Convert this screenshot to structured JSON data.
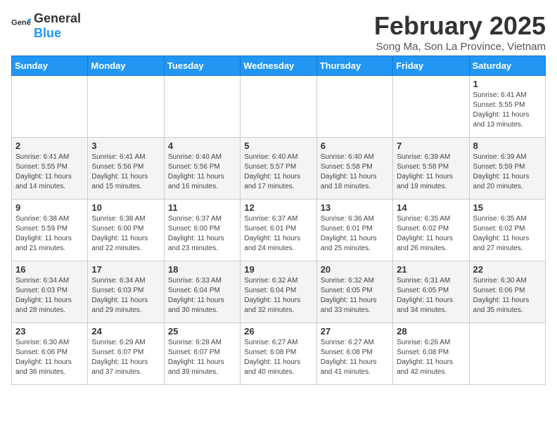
{
  "logo": {
    "text_general": "General",
    "text_blue": "Blue"
  },
  "title": "February 2025",
  "subtitle": "Song Ma, Son La Province, Vietnam",
  "days_of_week": [
    "Sunday",
    "Monday",
    "Tuesday",
    "Wednesday",
    "Thursday",
    "Friday",
    "Saturday"
  ],
  "weeks": [
    [
      {
        "day": "",
        "info": ""
      },
      {
        "day": "",
        "info": ""
      },
      {
        "day": "",
        "info": ""
      },
      {
        "day": "",
        "info": ""
      },
      {
        "day": "",
        "info": ""
      },
      {
        "day": "",
        "info": ""
      },
      {
        "day": "1",
        "info": "Sunrise: 6:41 AM\nSunset: 5:55 PM\nDaylight: 11 hours and 13 minutes."
      }
    ],
    [
      {
        "day": "2",
        "info": "Sunrise: 6:41 AM\nSunset: 5:55 PM\nDaylight: 11 hours and 14 minutes."
      },
      {
        "day": "3",
        "info": "Sunrise: 6:41 AM\nSunset: 5:56 PM\nDaylight: 11 hours and 15 minutes."
      },
      {
        "day": "4",
        "info": "Sunrise: 6:40 AM\nSunset: 5:56 PM\nDaylight: 11 hours and 16 minutes."
      },
      {
        "day": "5",
        "info": "Sunrise: 6:40 AM\nSunset: 5:57 PM\nDaylight: 11 hours and 17 minutes."
      },
      {
        "day": "6",
        "info": "Sunrise: 6:40 AM\nSunset: 5:58 PM\nDaylight: 11 hours and 18 minutes."
      },
      {
        "day": "7",
        "info": "Sunrise: 6:39 AM\nSunset: 5:58 PM\nDaylight: 11 hours and 19 minutes."
      },
      {
        "day": "8",
        "info": "Sunrise: 6:39 AM\nSunset: 5:59 PM\nDaylight: 11 hours and 20 minutes."
      }
    ],
    [
      {
        "day": "9",
        "info": "Sunrise: 6:38 AM\nSunset: 5:59 PM\nDaylight: 11 hours and 21 minutes."
      },
      {
        "day": "10",
        "info": "Sunrise: 6:38 AM\nSunset: 6:00 PM\nDaylight: 11 hours and 22 minutes."
      },
      {
        "day": "11",
        "info": "Sunrise: 6:37 AM\nSunset: 6:00 PM\nDaylight: 11 hours and 23 minutes."
      },
      {
        "day": "12",
        "info": "Sunrise: 6:37 AM\nSunset: 6:01 PM\nDaylight: 11 hours and 24 minutes."
      },
      {
        "day": "13",
        "info": "Sunrise: 6:36 AM\nSunset: 6:01 PM\nDaylight: 11 hours and 25 minutes."
      },
      {
        "day": "14",
        "info": "Sunrise: 6:35 AM\nSunset: 6:02 PM\nDaylight: 11 hours and 26 minutes."
      },
      {
        "day": "15",
        "info": "Sunrise: 6:35 AM\nSunset: 6:02 PM\nDaylight: 11 hours and 27 minutes."
      }
    ],
    [
      {
        "day": "16",
        "info": "Sunrise: 6:34 AM\nSunset: 6:03 PM\nDaylight: 11 hours and 28 minutes."
      },
      {
        "day": "17",
        "info": "Sunrise: 6:34 AM\nSunset: 6:03 PM\nDaylight: 11 hours and 29 minutes."
      },
      {
        "day": "18",
        "info": "Sunrise: 6:33 AM\nSunset: 6:04 PM\nDaylight: 11 hours and 30 minutes."
      },
      {
        "day": "19",
        "info": "Sunrise: 6:32 AM\nSunset: 6:04 PM\nDaylight: 11 hours and 32 minutes."
      },
      {
        "day": "20",
        "info": "Sunrise: 6:32 AM\nSunset: 6:05 PM\nDaylight: 11 hours and 33 minutes."
      },
      {
        "day": "21",
        "info": "Sunrise: 6:31 AM\nSunset: 6:05 PM\nDaylight: 11 hours and 34 minutes."
      },
      {
        "day": "22",
        "info": "Sunrise: 6:30 AM\nSunset: 6:06 PM\nDaylight: 11 hours and 35 minutes."
      }
    ],
    [
      {
        "day": "23",
        "info": "Sunrise: 6:30 AM\nSunset: 6:06 PM\nDaylight: 11 hours and 36 minutes."
      },
      {
        "day": "24",
        "info": "Sunrise: 6:29 AM\nSunset: 6:07 PM\nDaylight: 11 hours and 37 minutes."
      },
      {
        "day": "25",
        "info": "Sunrise: 6:28 AM\nSunset: 6:07 PM\nDaylight: 11 hours and 39 minutes."
      },
      {
        "day": "26",
        "info": "Sunrise: 6:27 AM\nSunset: 6:08 PM\nDaylight: 11 hours and 40 minutes."
      },
      {
        "day": "27",
        "info": "Sunrise: 6:27 AM\nSunset: 6:08 PM\nDaylight: 11 hours and 41 minutes."
      },
      {
        "day": "28",
        "info": "Sunrise: 6:26 AM\nSunset: 6:08 PM\nDaylight: 11 hours and 42 minutes."
      },
      {
        "day": "",
        "info": ""
      }
    ]
  ]
}
